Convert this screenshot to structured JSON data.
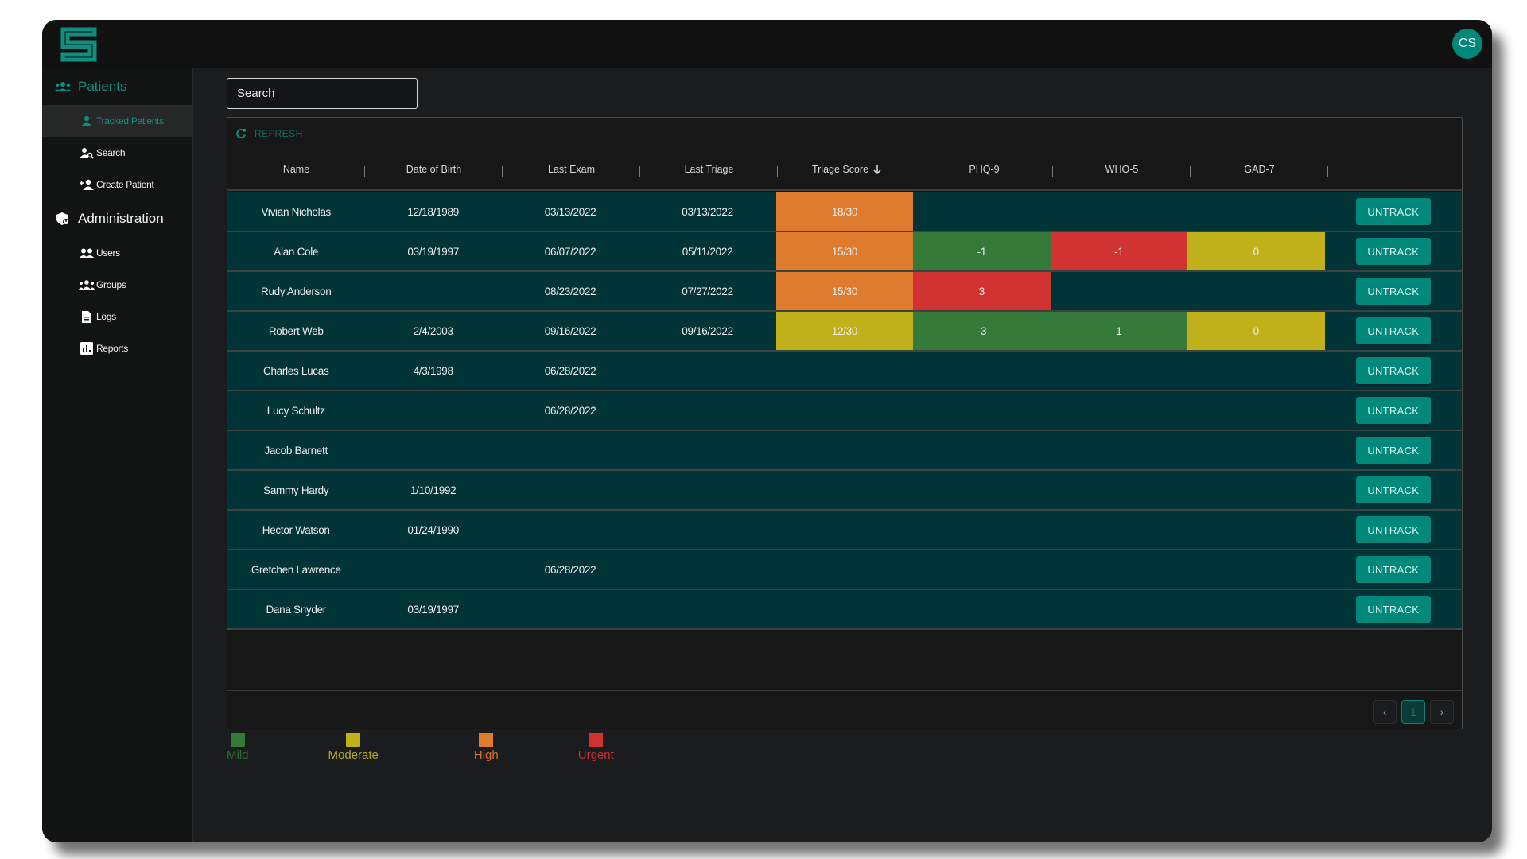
{
  "app": {
    "logo_icon": "s-maze-logo-icon",
    "user_initials": "CS"
  },
  "sidebar": {
    "patients_section": {
      "label": "Patients",
      "icon": "people-group-icon"
    },
    "patient_items": [
      {
        "label": "Tracked Patients",
        "icon": "person-icon",
        "active": true
      },
      {
        "label": "Search",
        "icon": "person-search-icon",
        "active": false
      },
      {
        "label": "Create Patient",
        "icon": "person-add-icon",
        "active": false
      }
    ],
    "admin_section": {
      "label": "Administration",
      "icon": "admin-shield-icon"
    },
    "admin_items": [
      {
        "label": "Users",
        "icon": "users-icon"
      },
      {
        "label": "Groups",
        "icon": "groups-icon"
      },
      {
        "label": "Logs",
        "icon": "document-icon"
      },
      {
        "label": "Reports",
        "icon": "bar-chart-icon"
      }
    ]
  },
  "search": {
    "placeholder": "Search",
    "value": ""
  },
  "toolbar": {
    "refresh_label": "REFRESH"
  },
  "table": {
    "columns": [
      "Name",
      "Date of Birth",
      "Last Exam",
      "Last Triage",
      "Triage Score",
      "PHQ-9",
      "WHO-5",
      "GAD-7"
    ],
    "sorted_column": "Triage Score",
    "sort_direction": "descending",
    "action_label": "UNTRACK",
    "rows": [
      {
        "name": "Vivian Nicholas",
        "dob": "12/18/1989",
        "last_exam": "03/13/2022",
        "last_triage": "03/13/2022",
        "triage_score": "18/30",
        "triage_sev": "high",
        "phq9": "",
        "phq9_sev": "",
        "who5": "",
        "who5_sev": "",
        "gad7": "",
        "gad7_sev": ""
      },
      {
        "name": "Alan Cole",
        "dob": "03/19/1997",
        "last_exam": "06/07/2022",
        "last_triage": "05/11/2022",
        "triage_score": "15/30",
        "triage_sev": "high",
        "phq9": "-1",
        "phq9_sev": "mild",
        "who5": "-1",
        "who5_sev": "urgent",
        "gad7": "0",
        "gad7_sev": "moderate"
      },
      {
        "name": "Rudy Anderson",
        "dob": "",
        "last_exam": "08/23/2022",
        "last_triage": "07/27/2022",
        "triage_score": "15/30",
        "triage_sev": "high",
        "phq9": "3",
        "phq9_sev": "urgent",
        "who5": "",
        "who5_sev": "",
        "gad7": "",
        "gad7_sev": ""
      },
      {
        "name": "Robert Web",
        "dob": "2/4/2003",
        "last_exam": "09/16/2022",
        "last_triage": "09/16/2022",
        "triage_score": "12/30",
        "triage_sev": "moderate",
        "phq9": "-3",
        "phq9_sev": "mild",
        "who5": "1",
        "who5_sev": "mild",
        "gad7": "0",
        "gad7_sev": "moderate"
      },
      {
        "name": "Charles Lucas",
        "dob": "4/3/1998",
        "last_exam": "06/28/2022",
        "last_triage": "",
        "triage_score": "",
        "triage_sev": "",
        "phq9": "",
        "phq9_sev": "",
        "who5": "",
        "who5_sev": "",
        "gad7": "",
        "gad7_sev": ""
      },
      {
        "name": "Lucy Schultz",
        "dob": "",
        "last_exam": "06/28/2022",
        "last_triage": "",
        "triage_score": "",
        "triage_sev": "",
        "phq9": "",
        "phq9_sev": "",
        "who5": "",
        "who5_sev": "",
        "gad7": "",
        "gad7_sev": ""
      },
      {
        "name": "Jacob Barnett",
        "dob": "",
        "last_exam": "",
        "last_triage": "",
        "triage_score": "",
        "triage_sev": "",
        "phq9": "",
        "phq9_sev": "",
        "who5": "",
        "who5_sev": "",
        "gad7": "",
        "gad7_sev": ""
      },
      {
        "name": "Sammy Hardy",
        "dob": "1/10/1992",
        "last_exam": "",
        "last_triage": "",
        "triage_score": "",
        "triage_sev": "",
        "phq9": "",
        "phq9_sev": "",
        "who5": "",
        "who5_sev": "",
        "gad7": "",
        "gad7_sev": ""
      },
      {
        "name": "Hector Watson",
        "dob": "01/24/1990",
        "last_exam": "",
        "last_triage": "",
        "triage_score": "",
        "triage_sev": "",
        "phq9": "",
        "phq9_sev": "",
        "who5": "",
        "who5_sev": "",
        "gad7": "",
        "gad7_sev": ""
      },
      {
        "name": "Gretchen Lawrence",
        "dob": "",
        "last_exam": "06/28/2022",
        "last_triage": "",
        "triage_score": "",
        "triage_sev": "",
        "phq9": "",
        "phq9_sev": "",
        "who5": "",
        "who5_sev": "",
        "gad7": "",
        "gad7_sev": ""
      },
      {
        "name": "Dana Snyder",
        "dob": "03/19/1997",
        "last_exam": "",
        "last_triage": "",
        "triage_score": "",
        "triage_sev": "",
        "phq9": "",
        "phq9_sev": "",
        "who5": "",
        "who5_sev": "",
        "gad7": "",
        "gad7_sev": ""
      }
    ]
  },
  "pagination": {
    "prev_icon": "chevron-left-icon",
    "current_page": "1",
    "next_icon": "chevron-right-icon"
  },
  "legend": [
    {
      "key": "mild",
      "label": "Mild",
      "color": "#357a38",
      "text_color": "#2e6e31"
    },
    {
      "key": "moderate",
      "label": "Moderate",
      "color": "#c0b11a",
      "text_color": "#b8a918"
    },
    {
      "key": "high",
      "label": "High",
      "color": "#de7b2d",
      "text_color": "#d9722a"
    },
    {
      "key": "urgent",
      "label": "Urgent",
      "color": "#d13333",
      "text_color": "#c92f2f"
    }
  ],
  "colors": {
    "accent": "#00897b",
    "row_background": "#003437",
    "mild": "#357a38",
    "moderate": "#c0b11a",
    "high": "#de7b2d",
    "urgent": "#d13333"
  }
}
